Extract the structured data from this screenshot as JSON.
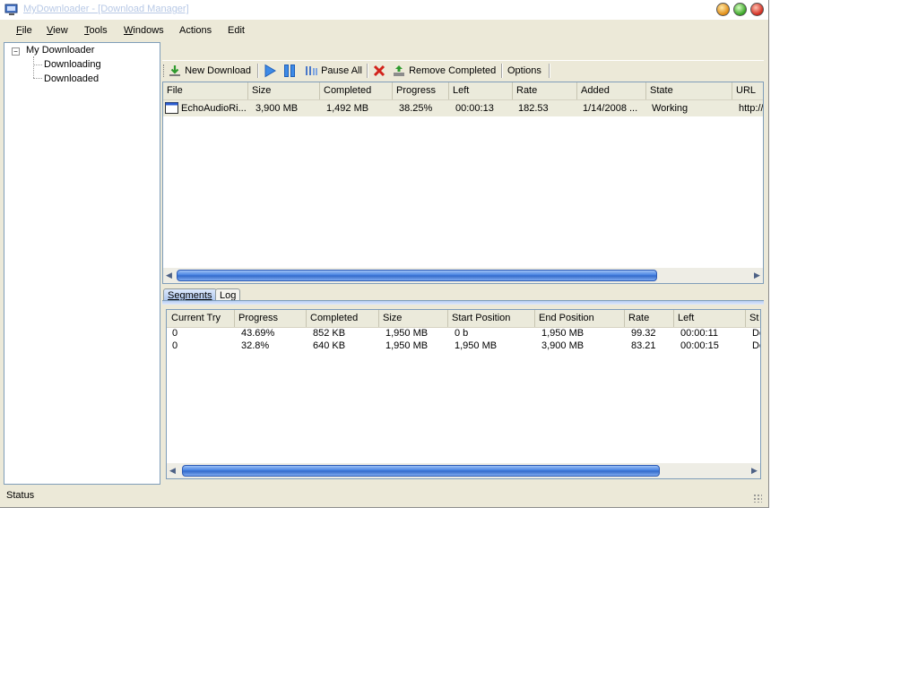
{
  "window": {
    "title": "MyDownloader - [Download Manager]"
  },
  "menu": {
    "file": {
      "u": "F",
      "rest": "ile"
    },
    "view": {
      "u": "V",
      "rest": "iew"
    },
    "tools": {
      "u": "T",
      "rest": "ools"
    },
    "windows": {
      "u": "W",
      "rest": "indows"
    },
    "actions": "Actions",
    "edit": "Edit"
  },
  "tree": {
    "root": "My Downloader",
    "children": [
      "Downloading",
      "Downloaded"
    ],
    "expander": "−"
  },
  "toolbar": {
    "new_download": "New Download",
    "pause_all": "Pause All",
    "remove_completed": "Remove Completed",
    "options": "Options"
  },
  "downloads": {
    "columns": [
      "File",
      "Size",
      "Completed",
      "Progress",
      "Left",
      "Rate",
      "Added",
      "State",
      "URL"
    ],
    "rows": [
      {
        "file": "EchoAudioRi...",
        "size": "3,900 MB",
        "completed": "1,492 MB",
        "progress": "38.25%",
        "left": "00:00:13",
        "rate": "182.53",
        "added": "1/14/2008 ...",
        "state": "Working",
        "url": "http://"
      }
    ]
  },
  "tabs": {
    "segments": "Segments",
    "log": "Log",
    "active": "Segments"
  },
  "segments": {
    "columns": [
      "Current Try",
      "Progress",
      "Completed",
      "Size",
      "Start Position",
      "End Position",
      "Rate",
      "Left",
      "St"
    ],
    "rows": [
      {
        "try": "0",
        "progress": "43.69%",
        "completed": "852 KB",
        "size": "1,950 MB",
        "start": "0 b",
        "end": "1,950 MB",
        "rate": "99.32",
        "left": "00:00:11",
        "state": "Do"
      },
      {
        "try": "0",
        "progress": "32.8%",
        "completed": "640 KB",
        "size": "1,950 MB",
        "start": "1,950 MB",
        "end": "3,900 MB",
        "rate": "83.21",
        "left": "00:00:15",
        "state": "Do"
      }
    ]
  },
  "status": {
    "text": "Status"
  },
  "icons": {
    "new_download": "download-arrow-icon",
    "start": "play-icon",
    "pause": "pause-icon",
    "pause_all": "pause-all-icon",
    "remove": "red-x-icon",
    "remove_completed": "recycle-icon"
  },
  "colors": {
    "selected_row": "#ecebdc",
    "scroll_thumb": "#3f7de0",
    "title_text": "#b8c9e6"
  }
}
